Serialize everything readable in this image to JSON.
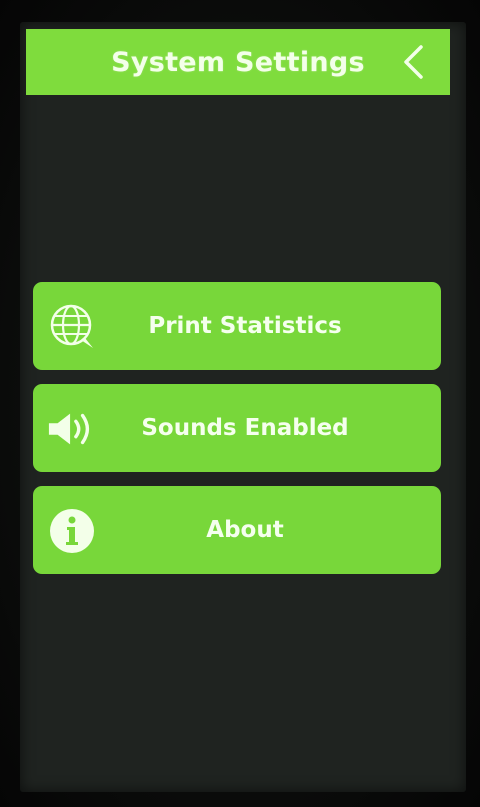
{
  "header": {
    "title": "System Settings",
    "back_icon": "chevron-left-icon"
  },
  "menu": {
    "items": [
      {
        "label": "Print Statistics",
        "icon": "globe-chat-icon"
      },
      {
        "label": "Sounds Enabled",
        "icon": "speaker-icon"
      },
      {
        "label": "About",
        "icon": "info-icon"
      }
    ]
  },
  "colors": {
    "accent": "#7fdc3d",
    "background": "#1f2320",
    "text": "#f3ffe9"
  }
}
